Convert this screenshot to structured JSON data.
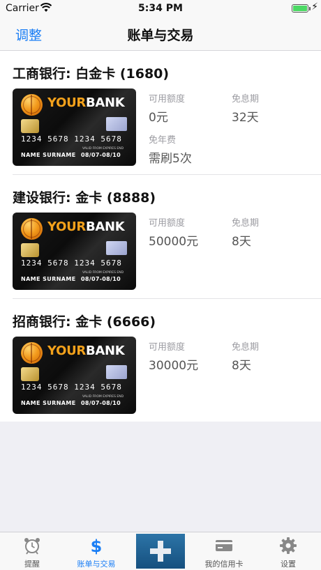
{
  "status": {
    "carrier": "Carrier",
    "time": "5:34 PM",
    "battery_fill": 1
  },
  "nav": {
    "left_button": "调整",
    "title": "账单与交易"
  },
  "card_image": {
    "brand_your": "YOUR",
    "brand_bank": "BANK",
    "number": "1234 5678 1234 5678",
    "name": "NAME SURNAME",
    "valid_from_label": "VALID FROM",
    "expires_label": "EXPIRES END",
    "validity": "08/07-08/10"
  },
  "cards": [
    {
      "title": "工商银行: 白金卡 (1680)",
      "credit_label": "可用额度",
      "credit_value": "0元",
      "free_label": "免息期",
      "free_value": "32天",
      "annual_label": "免年费",
      "annual_value": "需刷5次"
    },
    {
      "title": "建设银行: 金卡 (8888)",
      "credit_label": "可用额度",
      "credit_value": "50000元",
      "free_label": "免息期",
      "free_value": "8天"
    },
    {
      "title": "招商银行: 金卡 (6666)",
      "credit_label": "可用额度",
      "credit_value": "30000元",
      "free_label": "免息期",
      "free_value": "8天"
    }
  ],
  "tabs": [
    {
      "label": "提醒",
      "icon": "alarm-clock-icon"
    },
    {
      "label": "账单与交易",
      "icon": "dollar-icon",
      "active": true
    },
    {
      "label": "",
      "icon": "plus-icon"
    },
    {
      "label": "我的信用卡",
      "icon": "credit-card-icon"
    },
    {
      "label": "设置",
      "icon": "gear-icon"
    }
  ],
  "colors": {
    "accent": "#1a7ef5",
    "tab_add_bg": "#1f5f94",
    "card_brand_gold": "#f3a11b",
    "card_background": "#0c0c0c"
  }
}
